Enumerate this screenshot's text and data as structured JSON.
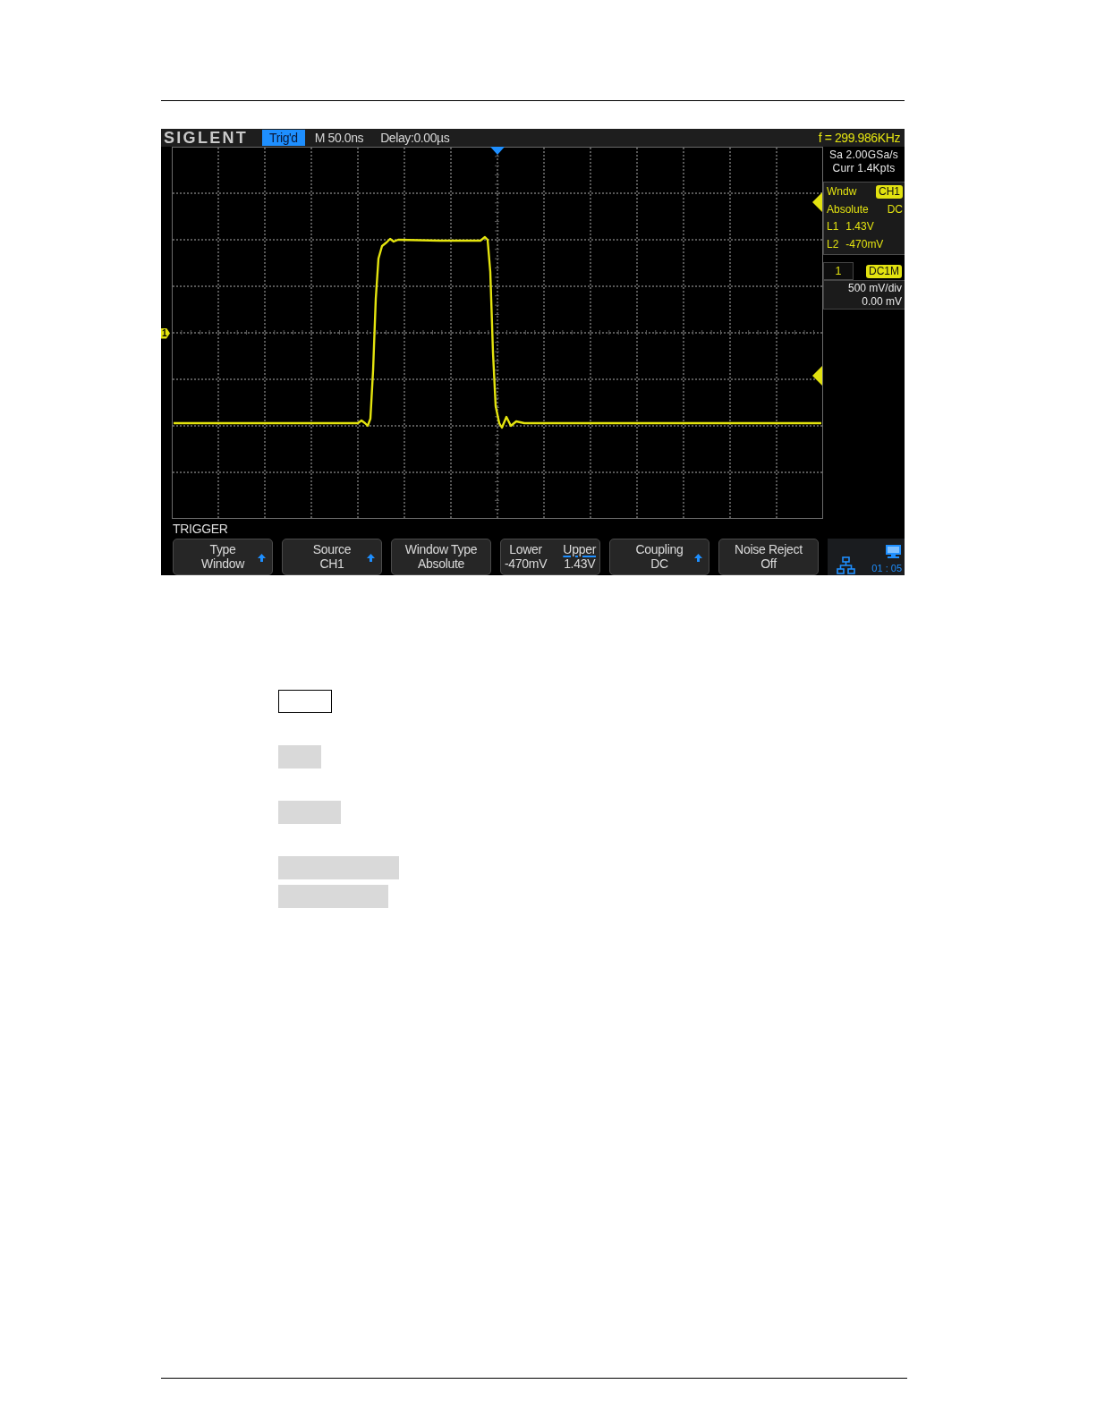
{
  "scope": {
    "top_bar": {
      "logo": "SIGLENT",
      "status": "Trig'd",
      "timebase": "M 50.0ns",
      "delay": "Delay:0.00µs",
      "frequency": "f = 299.986KHz"
    },
    "acquisition": {
      "sample_rate": "Sa 2.00GSa/s",
      "memory": "Curr 1.4Kpts"
    },
    "trigger_panel": {
      "type": "Wndw",
      "source": "CH1",
      "window_type": "Absolute",
      "coupling": "DC",
      "levels": [
        {
          "name": "L1",
          "value": "1.43V"
        },
        {
          "name": "L2",
          "value": "-470mV"
        }
      ]
    },
    "channel_panel": {
      "number": "1",
      "coupling": "DC1M",
      "scale": "500 mV/div",
      "offset": "0.00 mV"
    },
    "channel_marker": "1",
    "menu": {
      "title": "TRIGGER",
      "buttons": [
        {
          "kind": "item",
          "title": "Type",
          "value": "Window",
          "arrow": true
        },
        {
          "kind": "item",
          "title": "Source",
          "value": "CH1",
          "arrow": true
        },
        {
          "kind": "item",
          "title": "Window Type",
          "value": "Absolute",
          "arrow": false
        },
        {
          "kind": "split",
          "parts": [
            {
              "title": "Lower",
              "value": "-470mV",
              "selected": false
            },
            {
              "title": "Upper",
              "value": "1.43V",
              "selected": true
            }
          ]
        },
        {
          "kind": "item",
          "title": "Coupling",
          "value": "DC",
          "arrow": true
        },
        {
          "kind": "item",
          "title": "Noise Reject",
          "value": "Off",
          "arrow": false
        }
      ]
    },
    "status": {
      "time": "01 : 05"
    }
  },
  "block_groups": [
    {
      "blocks": [
        {
          "kind": "outlined"
        }
      ]
    },
    {
      "blocks": [
        {
          "kind": "shaded"
        }
      ]
    },
    {
      "blocks": [
        {
          "kind": "shaded"
        }
      ]
    },
    {
      "blocks": [
        {
          "kind": "shaded"
        },
        {
          "kind": "shaded"
        }
      ]
    }
  ]
}
